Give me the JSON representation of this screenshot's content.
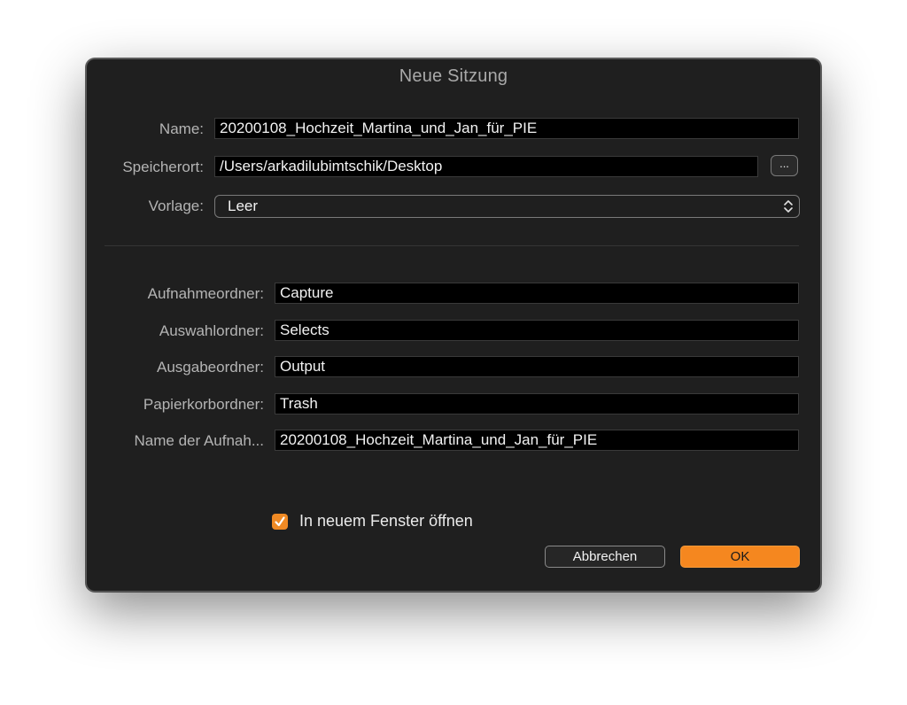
{
  "dialog": {
    "title": "Neue Sitzung"
  },
  "form": {
    "name_label": "Name:",
    "name_value": "20200108_Hochzeit_Martina_und_Jan_für_PIE",
    "location_label": "Speicherort:",
    "location_value": "/Users/arkadilubimtschik/Desktop",
    "browse_label": "...",
    "template_label": "Vorlage:",
    "template_value": "Leer"
  },
  "folders": {
    "capture_label": "Aufnahmeordner:",
    "capture_value": "Capture",
    "selects_label": "Auswahlordner:",
    "selects_value": "Selects",
    "output_label": "Ausgabeordner:",
    "output_value": "Output",
    "trash_label": "Papierkorbordner:",
    "trash_value": "Trash",
    "capture_name_label": "Name der Aufnah...",
    "capture_name_value": "20200108_Hochzeit_Martina_und_Jan_für_PIE"
  },
  "options": {
    "open_new_window_label": "In neuem Fenster öffnen",
    "open_new_window_checked": true
  },
  "buttons": {
    "cancel_label": "Abbrechen",
    "ok_label": "OK"
  },
  "colors": {
    "accent": "#f5871f",
    "dialog_bg": "#1f1f1f",
    "field_bg": "#000000"
  }
}
